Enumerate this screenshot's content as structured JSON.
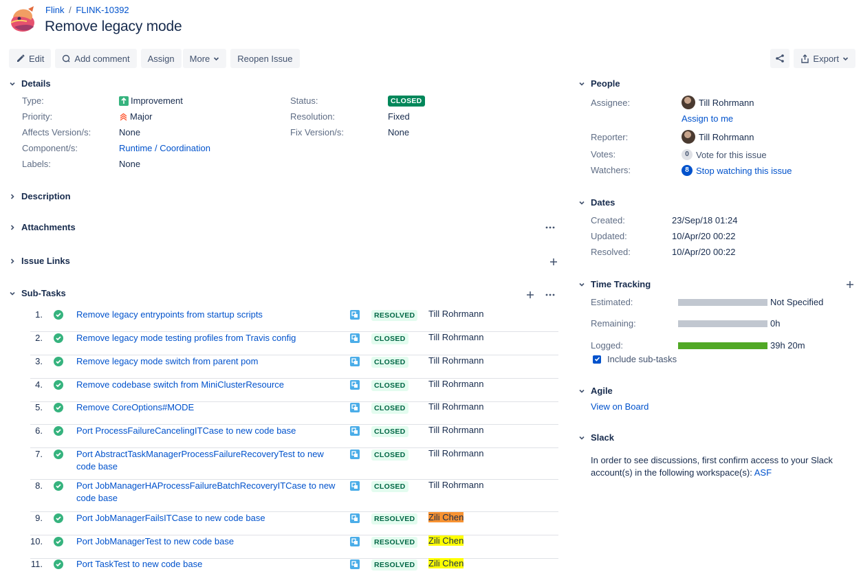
{
  "breadcrumb": {
    "project": "Flink",
    "separator": "/",
    "issue_key": "FLINK-10392"
  },
  "title": "Remove legacy mode",
  "toolbar": {
    "edit": "Edit",
    "add_comment": "Add comment",
    "assign": "Assign",
    "more": "More",
    "reopen": "Reopen Issue",
    "export": "Export"
  },
  "details": {
    "heading": "Details",
    "type_label": "Type:",
    "type_value": "Improvement",
    "priority_label": "Priority:",
    "priority_value": "Major",
    "affects_label": "Affects Version/s:",
    "affects_value": "None",
    "component_label": "Component/s:",
    "component_value": "Runtime / Coordination",
    "labels_label": "Labels:",
    "labels_value": "None",
    "status_label": "Status:",
    "status_value": "CLOSED",
    "resolution_label": "Resolution:",
    "resolution_value": "Fixed",
    "fix_label": "Fix Version/s:",
    "fix_value": "None"
  },
  "sections": {
    "description": "Description",
    "attachments": "Attachments",
    "issue_links": "Issue Links",
    "subtasks": "Sub-Tasks"
  },
  "subtasks": [
    {
      "num": "1.",
      "title": "Remove legacy entrypoints from startup scripts",
      "status": "RESOLVED",
      "assignee": "Till Rohrmann"
    },
    {
      "num": "2.",
      "title": "Remove legacy mode testing profiles from Travis config",
      "status": "CLOSED",
      "assignee": "Till Rohrmann"
    },
    {
      "num": "3.",
      "title": "Remove legacy mode switch from parent pom",
      "status": "CLOSED",
      "assignee": "Till Rohrmann"
    },
    {
      "num": "4.",
      "title": "Remove codebase switch from MiniClusterResource",
      "status": "CLOSED",
      "assignee": "Till Rohrmann"
    },
    {
      "num": "5.",
      "title": "Remove CoreOptions#MODE",
      "status": "CLOSED",
      "assignee": "Till Rohrmann"
    },
    {
      "num": "6.",
      "title": "Port ProcessFailureCancelingITCase to new code base",
      "status": "CLOSED",
      "assignee": "Till Rohrmann"
    },
    {
      "num": "7.",
      "title": "Port AbstractTaskManagerProcessFailureRecoveryTest to new code base",
      "status": "CLOSED",
      "assignee": "Till Rohrmann"
    },
    {
      "num": "8.",
      "title": "Port JobManagerHAProcessFailureBatchRecoveryITCase to new code base",
      "status": "CLOSED",
      "assignee": "Till Rohrmann"
    },
    {
      "num": "9.",
      "title": "Port JobManagerFailsITCase to new code base",
      "status": "RESOLVED",
      "assignee": "Zili Chen"
    },
    {
      "num": "10.",
      "title": "Port JobManagerTest to new code base",
      "status": "RESOLVED",
      "assignee": "Zili Chen"
    },
    {
      "num": "11.",
      "title": "Port TaskTest to new code base",
      "status": "RESOLVED",
      "assignee": "Zili Chen"
    }
  ],
  "people": {
    "heading": "People",
    "assignee_label": "Assignee:",
    "assignee": "Till Rohrmann",
    "assign_to_me": "Assign to me",
    "reporter_label": "Reporter:",
    "reporter": "Till Rohrmann",
    "votes_label": "Votes:",
    "votes_count": "0",
    "votes_text": "Vote for this issue",
    "watchers_label": "Watchers:",
    "watchers_count": "8",
    "watchers_text": "Stop watching this issue"
  },
  "dates": {
    "heading": "Dates",
    "created_label": "Created:",
    "created": "23/Sep/18 01:24",
    "updated_label": "Updated:",
    "updated": "10/Apr/20 00:22",
    "resolved_label": "Resolved:",
    "resolved": "10/Apr/20 00:22"
  },
  "time_tracking": {
    "heading": "Time Tracking",
    "estimated_label": "Estimated:",
    "estimated": "Not Specified",
    "estimated_fill": 0,
    "remaining_label": "Remaining:",
    "remaining": "0h",
    "remaining_fill": 0,
    "logged_label": "Logged:",
    "logged": "39h 20m",
    "logged_fill": 1,
    "include_subtasks": "Include sub-tasks"
  },
  "agile": {
    "heading": "Agile",
    "view_on_board": "View on Board"
  },
  "slack": {
    "heading": "Slack",
    "text_line1": "In order to see discussions, first confirm access to your Slack",
    "text_line2": "account(s) in the following workspace(s):",
    "workspace": "ASF"
  },
  "colors": {
    "accent": "#0052cc",
    "closed_green": "#00875a",
    "tracking_grey": "#c1c7d0",
    "tracking_green": "#51a825"
  }
}
